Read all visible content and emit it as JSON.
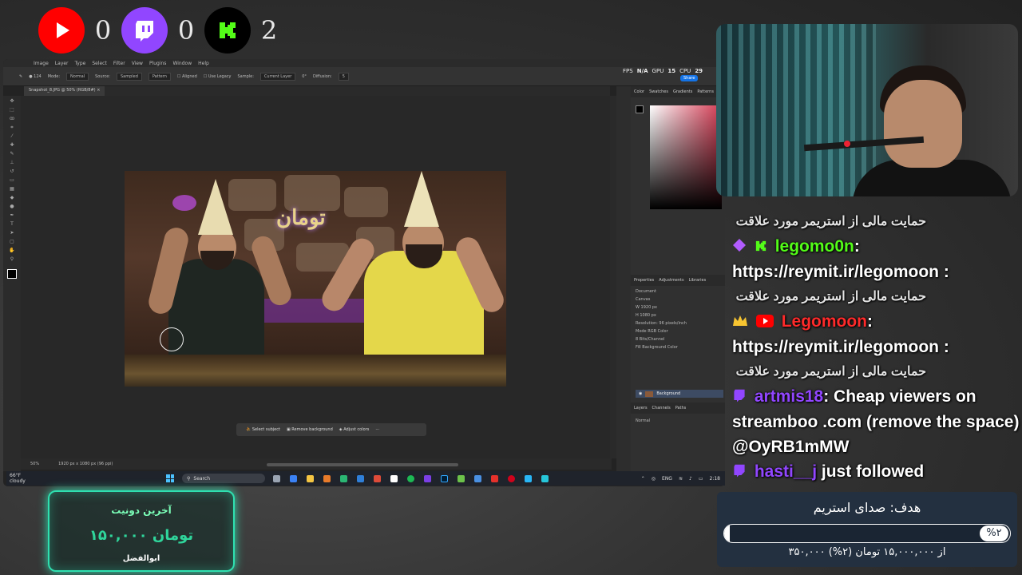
{
  "counters": [
    {
      "platform": "youtube",
      "icon": "youtube-icon",
      "color": "#ff0000",
      "count": "0"
    },
    {
      "platform": "twitch",
      "icon": "twitch-icon",
      "color": "#9146ff",
      "count": "0"
    },
    {
      "platform": "kick",
      "icon": "kick-icon",
      "color": "#000000",
      "count": "2"
    }
  ],
  "photoshop": {
    "menu": [
      "Image",
      "Layer",
      "Type",
      "Select",
      "Filter",
      "View",
      "Plugins",
      "Window",
      "Help"
    ],
    "options": {
      "mode_label": "Mode:",
      "mode_value": "Normal",
      "source_label": "Source:",
      "sampled": "Sampled",
      "pattern": "Pattern",
      "aligned": "Aligned",
      "use_legacy": "Use Legacy",
      "sample_label": "Sample:",
      "sample_value": "Current Layer",
      "angle": "0°",
      "diffusion_label": "Diffusion:",
      "diffusion_value": "5",
      "brush_size": "124"
    },
    "document_tab": "Snapshot_8.JPG @ 50% (RGB/8#)",
    "canvas_text": "تومان",
    "fps": {
      "fps_label": "FPS",
      "fps_value": "N/A",
      "gpu_label": "GPU",
      "gpu_value": "15",
      "cpu_label": "CPU",
      "cpu_value": "29"
    },
    "share": "Share",
    "panels": {
      "color_tabs": [
        "Color",
        "Swatches",
        "Gradients",
        "Patterns"
      ],
      "prop_tabs": [
        "Properties",
        "Adjustments",
        "Libraries"
      ],
      "document": "Document",
      "canvas": "Canvas",
      "width": "1920 px",
      "height": "1080 px",
      "resolution": "Resolution: 96 pixels/inch",
      "mode_label": "Mode",
      "mode": "RGB Color",
      "bits": "8 Bits/Channel",
      "fill_label": "Fill",
      "fill": "Background Color",
      "layers_tabs": [
        "Layers",
        "Channels",
        "Paths"
      ],
      "layer_mode": "Normal",
      "layer_name": "Background"
    },
    "context": [
      "Select subject",
      "Remove background",
      "Adjust colors"
    ],
    "status": {
      "zoom": "50%",
      "size": "1920 px x 1080 px (96 ppi)"
    }
  },
  "taskbar": {
    "weather_temp": "66°F",
    "weather_desc": "cloudy",
    "search": "Search",
    "lang": "ENG",
    "time": "2:18"
  },
  "chat": [
    {
      "type": "rtl",
      "text": "حمایت مالی از استریمر مورد علاقت"
    },
    {
      "type": "msg",
      "platform": "kick",
      "badge": "purple-diamond-icon",
      "user": "legomo0n",
      "text": ": https://reymit.ir/legomoon :"
    },
    {
      "type": "rtl",
      "text": "حمایت مالی از استریمر مورد علاقت"
    },
    {
      "type": "msg",
      "platform": "youtube",
      "badge": "crown-icon",
      "user": "Legomoon",
      "text": ": https://reymit.ir/legomoon :"
    },
    {
      "type": "rtl",
      "text": "حمایت مالی از استریمر مورد علاقت"
    },
    {
      "type": "msg",
      "platform": "twitch",
      "user": "artmis18",
      "text": ": Cheap viewers on streamboo .com (remove the space) @OyRB1mMW"
    },
    {
      "type": "msg",
      "platform": "twitch",
      "user": "hasti__j",
      "text": " just followed"
    }
  ],
  "donation": {
    "title": "آخرین دونیت",
    "amount": "۱۵۰,۰۰۰ تومان",
    "name": "ابوالفضل"
  },
  "goal": {
    "title": "هدف: صدای استریم",
    "percent_label": "%۲",
    "progress": 0.02,
    "subtitle": "۳۵۰,۰۰۰ از ۱۵,۰۰۰,۰۰۰ تومان (۲%)"
  }
}
